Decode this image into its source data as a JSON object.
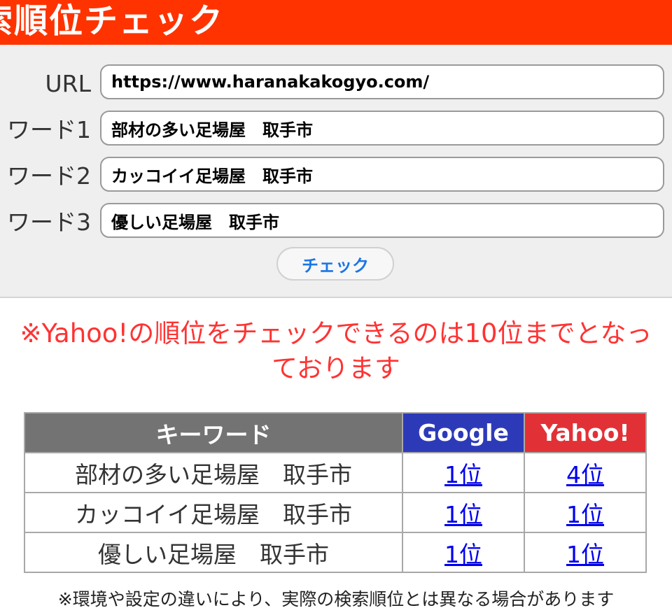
{
  "header": {
    "title": "索順位チェック"
  },
  "form": {
    "url_label": "URL",
    "url_value": "https://www.haranakakogyo.com/",
    "keywords": [
      {
        "label": "ワード1",
        "value": "部材の多い足場屋　取手市"
      },
      {
        "label": "ワード2",
        "value": "カッコイイ足場屋　取手市"
      },
      {
        "label": "ワード3",
        "value": "優しい足場屋　取手市"
      }
    ],
    "check_button": "チェック"
  },
  "notice": {
    "line1": "※Yahoo!の順位をチェックできるのは10位までとなっ",
    "line2": "ております"
  },
  "results": {
    "headers": {
      "keyword": "キーワード",
      "google": "Google",
      "yahoo": "Yahoo!"
    },
    "rows": [
      {
        "keyword": "部材の多い足場屋　取手市",
        "google": "1位",
        "yahoo": "4位"
      },
      {
        "keyword": "カッコイイ足場屋　取手市",
        "google": "1位",
        "yahoo": "1位"
      },
      {
        "keyword": "優しい足場屋　取手市",
        "google": "1位",
        "yahoo": "1位"
      }
    ]
  },
  "disclaimer": "※環境や設定の違いにより、実際の検索順位とは異なる場合があります",
  "colors": {
    "header_bg": "#ff3300",
    "google": "#2d3ab8",
    "yahoo": "#e23136",
    "notice": "#ff3333",
    "link": "#0000ee"
  }
}
